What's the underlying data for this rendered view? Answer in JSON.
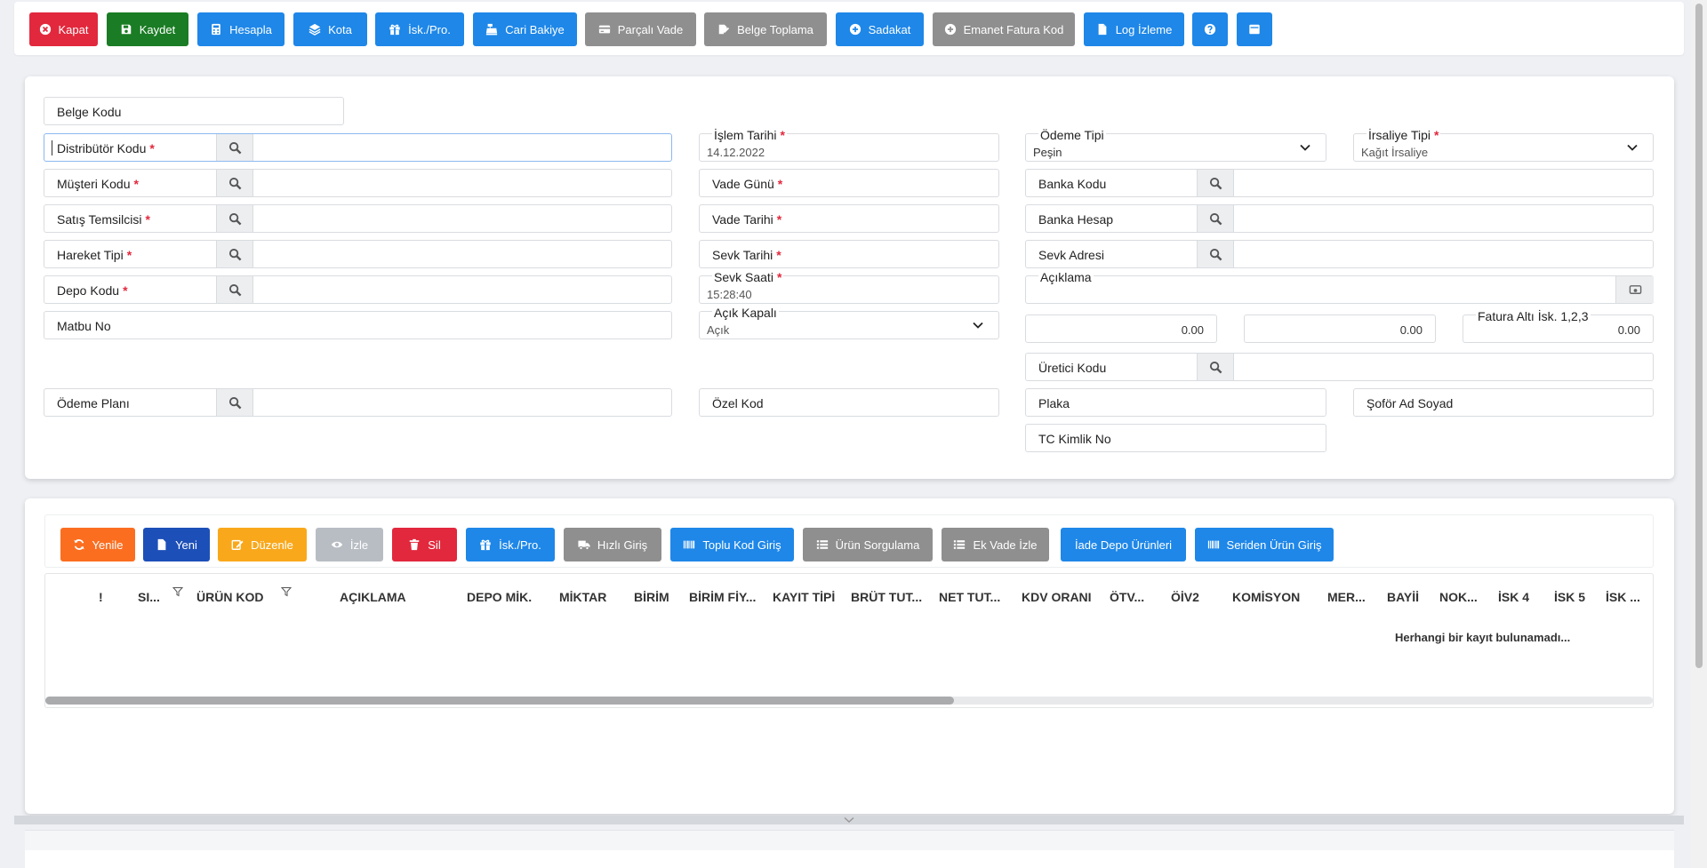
{
  "toolbar": {
    "buttons": [
      {
        "label": "Kapat",
        "icon": "close-circle-icon",
        "color": "#e2283d"
      },
      {
        "label": "Kaydet",
        "icon": "save-icon",
        "color": "#1a7c24"
      },
      {
        "label": "Hesapla",
        "icon": "calculator-icon",
        "color": "#1e87e8"
      },
      {
        "label": "Kota",
        "icon": "layers-icon",
        "color": "#1e87e8"
      },
      {
        "label": "İsk./Pro.",
        "icon": "gift-icon",
        "color": "#1e87e8"
      },
      {
        "label": "Cari Bakiye",
        "icon": "cash-register-icon",
        "color": "#1e87e8"
      },
      {
        "label": "Parçalı Vade",
        "icon": "credit-card-icon",
        "color": "#8f8f8f"
      },
      {
        "label": "Belge Toplama",
        "icon": "signature-icon",
        "color": "#8f8f8f"
      },
      {
        "label": "Sadakat",
        "icon": "plus-circle-icon",
        "color": "#1e87e8"
      },
      {
        "label": "Emanet Fatura Kod",
        "icon": "plus-circle-icon",
        "color": "#8f8f8f"
      },
      {
        "label": "Log İzleme",
        "icon": "file-icon",
        "color": "#1e87e8"
      },
      {
        "label": "",
        "icon": "help-icon",
        "color": "#1e87e8"
      },
      {
        "label": "",
        "icon": "window-icon",
        "color": "#1e87e8"
      }
    ]
  },
  "form": {
    "belge_kodu": "Belge Kodu",
    "distributor_kodu": "Distribütör Kodu",
    "musteri_kodu": "Müşteri Kodu",
    "satis_temsilcisi": "Satış Temsilcisi",
    "hareket_tipi": "Hareket Tipi",
    "depo_kodu": "Depo Kodu",
    "matbu_no": "Matbu No",
    "odeme_plani": "Ödeme Planı",
    "islem_tarihi_label": "İşlem Tarihi",
    "islem_tarihi_value": "14.12.2022",
    "vade_gunu": "Vade Günü",
    "vade_tarihi": "Vade Tarihi",
    "sevk_tarihi": "Sevk Tarihi",
    "sevk_saati_label": "Sevk Saati",
    "sevk_saati_value": "15:28:40",
    "acik_kapali_label": "Açık Kapalı",
    "acik_kapali_value": "Açık",
    "ozel_kod": "Özel Kod",
    "odeme_tipi_label": "Ödeme Tipi",
    "odeme_tipi_value": "Peşin",
    "irsaliye_tipi_label": "İrsaliye Tipi",
    "irsaliye_tipi_value": "Kağıt İrsaliye",
    "banka_kodu": "Banka Kodu",
    "banka_hesap": "Banka Hesap",
    "sevk_adresi": "Sevk Adresi",
    "aciklama": "Açıklama",
    "iskonto1": "0.00",
    "iskonto2": "0.00",
    "fatura_alti_label": "Fatura Altı İsk. 1,2,3",
    "iskonto3": "0.00",
    "uretici_kodu": "Üretici Kodu",
    "plaka": "Plaka",
    "sofor": "Şoför Ad Soyad",
    "tc_kimlik": "TC Kimlik No"
  },
  "grid_toolbar": {
    "buttons": [
      {
        "label": "Yenile",
        "icon": "refresh-icon",
        "color": "#fb6e20"
      },
      {
        "label": "Yeni",
        "icon": "new-file-icon",
        "color": "#1d4fb8"
      },
      {
        "label": "Düzenle",
        "icon": "edit-icon",
        "color": "#f9a81b"
      },
      {
        "label": "İzle",
        "icon": "eye-icon",
        "color": "#b8bdc4"
      },
      {
        "label": "Sil",
        "icon": "trash-icon",
        "color": "#e2283d"
      },
      {
        "label": "İsk./Pro.",
        "icon": "gift-icon",
        "color": "#1e87e8"
      },
      {
        "label": "Hızlı Giriş",
        "icon": "truck-icon",
        "color": "#8f8f8f"
      },
      {
        "label": "Toplu Kod Giriş",
        "icon": "barcode-icon",
        "color": "#1e87e8"
      },
      {
        "label": "Ürün Sorgulama",
        "icon": "list-icon",
        "color": "#8f8f8f"
      },
      {
        "label": "Ek Vade İzle",
        "icon": "list-icon",
        "color": "#8f8f8f"
      },
      {
        "label": "İade Depo Ürünleri",
        "icon": "",
        "color": "#1e87e8"
      },
      {
        "label": "Seriden Ürün Giriş",
        "icon": "barcode-icon",
        "color": "#1e87e8"
      }
    ]
  },
  "grid": {
    "columns": [
      "!",
      "SI...",
      "ÜRÜN KOD",
      "AÇIKLAMA",
      "DEPO MİK.",
      "MİKTAR",
      "BİRİM",
      "BİRİM FİY...",
      "KAYIT TİPİ",
      "BRÜT TUT...",
      "NET TUT...",
      "KDV ORANI",
      "ÖTV...",
      "ÖİV2",
      "KOMİSYON",
      "MER...",
      "BAYİİ",
      "NOK...",
      "İSK 4",
      "İSK 5",
      "İSK ..."
    ],
    "empty_message": "Herhangi bir kayıt bulunamadı...",
    "scroll_fraction": 0.565
  }
}
